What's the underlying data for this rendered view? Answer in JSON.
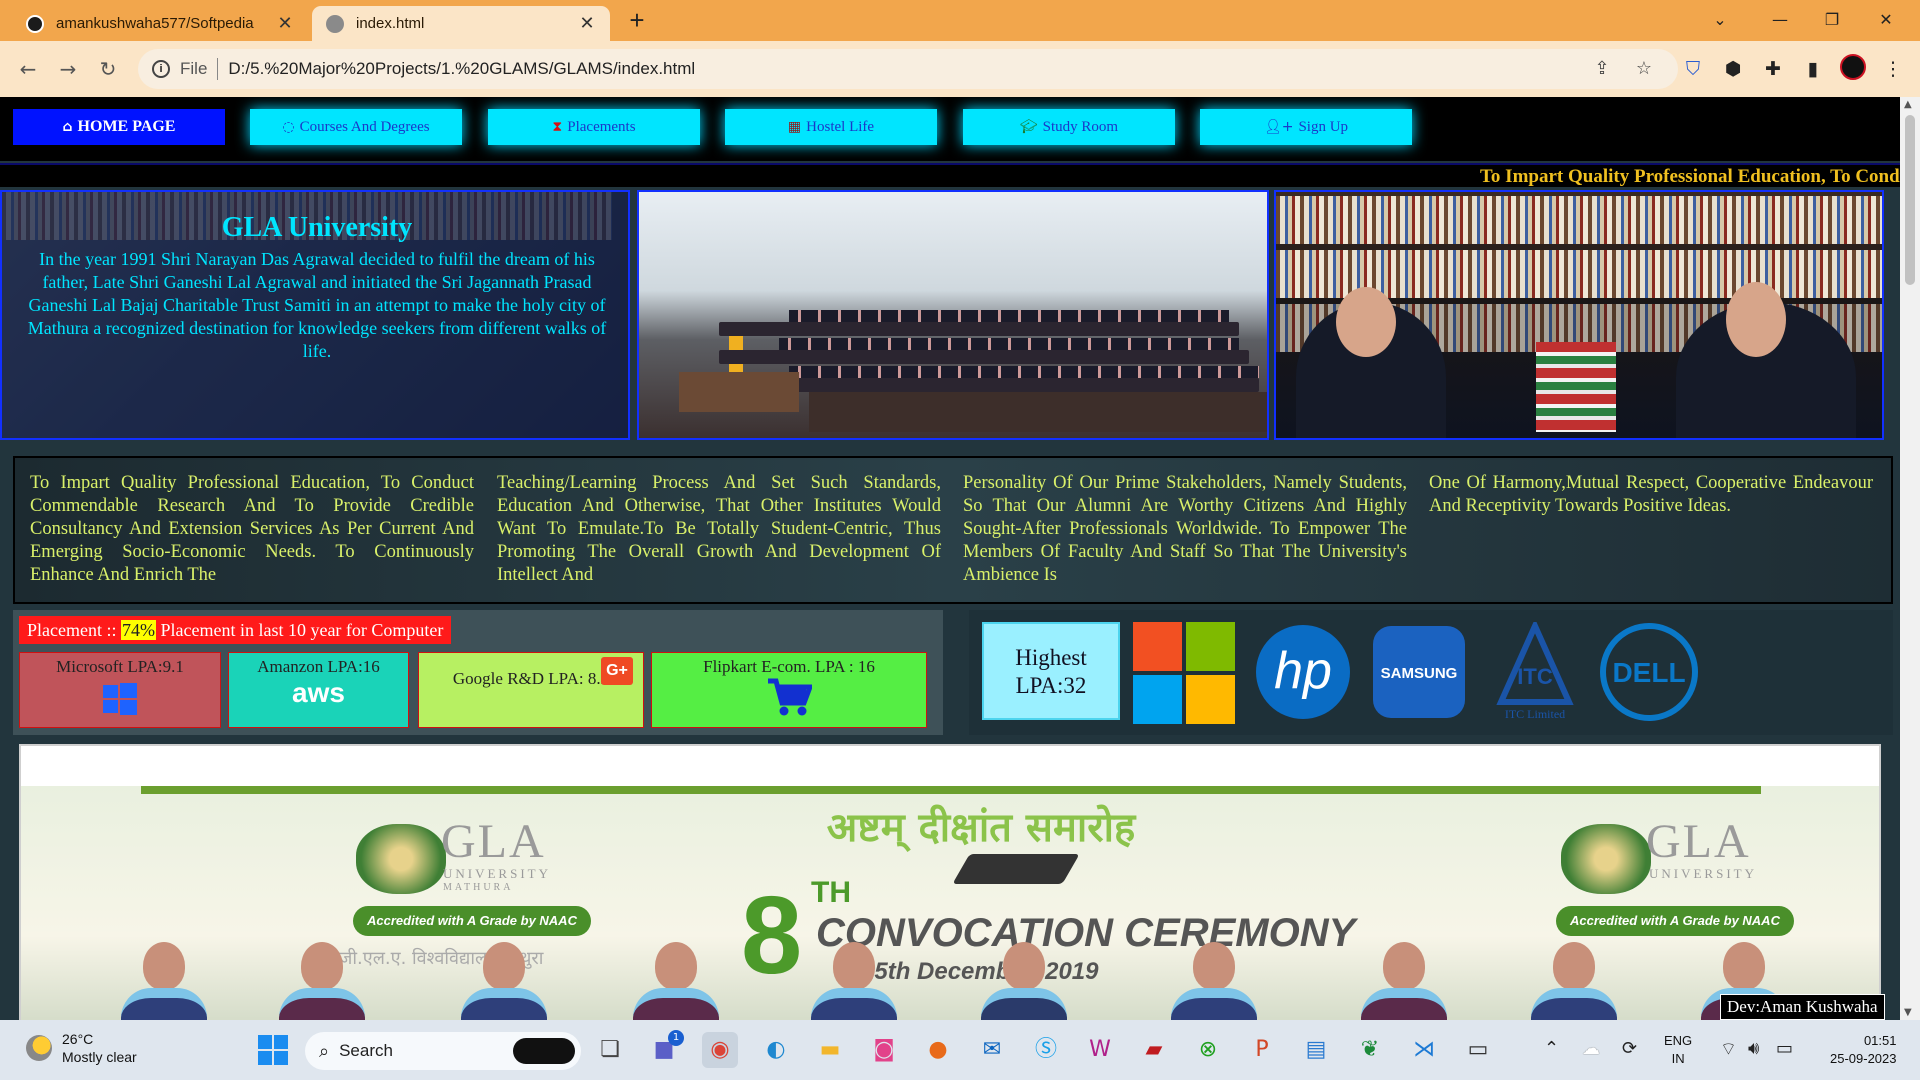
{
  "browser": {
    "tabs": [
      {
        "title": "amankushwaha577/Softpedia"
      },
      {
        "title": "index.html"
      }
    ],
    "url_scheme": "File",
    "url": "D:/5.%20Major%20Projects/1.%20GLAMS/GLAMS/index.html"
  },
  "nav": {
    "items": [
      {
        "label": "HOME PAGE",
        "icon": "home-icon"
      },
      {
        "label": "Courses And Degrees",
        "icon": "chat-icon"
      },
      {
        "label": "Placements",
        "icon": "hourglass-icon"
      },
      {
        "label": "Hostel Life",
        "icon": "building-icon"
      },
      {
        "label": "Study Room",
        "icon": "graduation-cap-icon"
      },
      {
        "label": "Sign Up",
        "icon": "user-plus-icon"
      }
    ]
  },
  "marquee": {
    "text": "To Impart Quality Professional Education, To Condu"
  },
  "hero": {
    "title": "GLA University",
    "text": "In the year 1991 Shri Narayan Das Agrawal decided to fulfil the dream of his father, Late Shri Ganeshi Lal Agrawal and initiated the Sri Jagannath Prasad Ganeshi Lal Bajaj Charitable Trust Samiti in an attempt to make the holy city of Mathura a recognized destination for knowledge seekers from different walks of life."
  },
  "mission": {
    "columns": [
      "To Impart Quality Professional Education, To Conduct Commendable Research And To Provide Credible Consultancy And Extension Services As Per Current And Emerging Socio-Economic Needs. To Continuously Enhance And Enrich The",
      "Teaching/Learning Process And Set Such Standards, Education And Otherwise, That Other Institutes Would Want To Emulate.To Be Totally Student-Centric, Thus Promoting The Overall Growth And Development Of Intellect And",
      "Personality Of Our Prime Stakeholders, Namely Students, So That Our Alumni Are Worthy Citizens And Highly Sought-After Professionals Worldwide. To Empower The Members Of Faculty And Staff So That The University's Ambience Is",
      "One Of Harmony,Mutual Respect, Cooperative Endeavour And Receptivity Towards Positive Ideas."
    ]
  },
  "placement": {
    "head_prefix": "Placement :: ",
    "percent": "74%",
    "head_suffix": " Placement in last 10 year for Computer",
    "cards": [
      {
        "label": "Microsoft LPA:9.1",
        "color": "#c0545a",
        "icon": "windows-icon"
      },
      {
        "label": "Amanzon LPA:16",
        "color": "#1ad3b8",
        "icon": "aws-icon"
      },
      {
        "label": "Google R&D LPA: 8.2",
        "color": "#b7f062",
        "icon": "google-plus-icon"
      },
      {
        "label": "Flipkart E-com. LPA : 16",
        "color": "#55ee44",
        "icon": "cart-icon"
      }
    ]
  },
  "recruiters": {
    "highest_line1": "Highest",
    "highest_line2": "LPA:32",
    "logos": [
      "microsoft-logo",
      "hp-logo",
      "samsung-logo",
      "itc-logo",
      "dell-logo"
    ],
    "samsung_text": "SAMSUNG",
    "hp_text": "hp",
    "dell_text": "DELL",
    "itc_text": "ITC",
    "itc_sub": "ITC Limited"
  },
  "banner": {
    "hindi_title": "अष्टम् दीक्षांत समारोह",
    "number": "8",
    "suffix": "TH",
    "title": "CONVOCATION CEREMONY",
    "date": "15th December, 2019",
    "brand": "GLA",
    "brand_sub": "UNIVERSITY",
    "brand_city": "MATHURA",
    "naac": "Accredited with  A  Grade by NAAC",
    "hindi_sub": "जी.एल.ए. विश्वविद्यालय, मथुरा"
  },
  "dev_tag": "Dev:Aman Kushwaha",
  "taskbar": {
    "temperature": "26°C",
    "weather": "Mostly clear",
    "search": "Search",
    "lang1": "ENG",
    "lang2": "IN",
    "time": "01:51",
    "date": "25-09-2023",
    "teams_badge": "1"
  },
  "colors": {
    "accent_cyan": "#00e5ff",
    "home_blue": "#0012ff",
    "mission_text": "#d9f06a",
    "marquee_text": "#f0c020",
    "tabbar": "#f2a64c"
  }
}
